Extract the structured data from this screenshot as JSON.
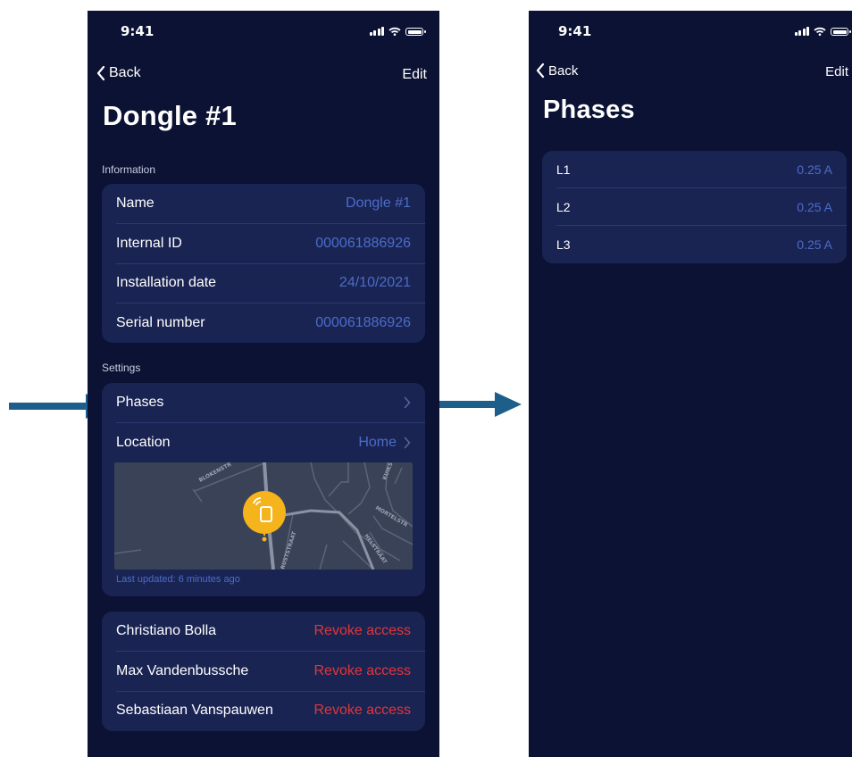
{
  "left": {
    "status": {
      "time": "9:41"
    },
    "nav": {
      "back": "Back",
      "edit": "Edit"
    },
    "title": "Dongle #1",
    "information": {
      "header": "Information",
      "rows": [
        {
          "label": "Name",
          "value": "Dongle #1"
        },
        {
          "label": "Internal ID",
          "value": "000061886926"
        },
        {
          "label": "Installation date",
          "value": "24/10/2021"
        },
        {
          "label": "Serial number",
          "value": "000061886926"
        }
      ]
    },
    "settings": {
      "header": "Settings",
      "phases_label": "Phases",
      "location_label": "Location",
      "location_value": "Home",
      "last_updated": "Last updated: 6 minutes ago",
      "map_streets": [
        "BLOKENSTR",
        "KUIKS",
        "MORTELSTR",
        "HELSTRAAT",
        "RUSTSTRAAT"
      ]
    },
    "access": {
      "revoke_label": "Revoke access",
      "users": [
        "Christiano Bolla",
        "Max Vandenbussche",
        "Sebastiaan Vanspauwen"
      ]
    }
  },
  "right": {
    "status": {
      "time": "9:41"
    },
    "nav": {
      "back": "Back",
      "edit": "Edit"
    },
    "title": "Phases",
    "phases": [
      {
        "label": "L1",
        "value": "0.25 A"
      },
      {
        "label": "L2",
        "value": "0.25 A"
      },
      {
        "label": "L3",
        "value": "0.25 A"
      }
    ]
  },
  "colors": {
    "screen_bg": "#0c1233",
    "card_bg": "#1a2453",
    "value_blue": "#4b6cc9",
    "revoke_red": "#e0363a",
    "pin_yellow": "#f5b31c",
    "arrow_blue": "#1d5f8a"
  }
}
